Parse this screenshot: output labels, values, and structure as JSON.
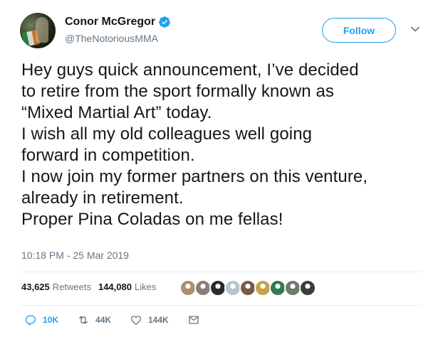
{
  "user": {
    "name": "Conor McGregor",
    "handle": "@TheNotoriousMMA",
    "verified": true
  },
  "follow_button": {
    "label": "Follow"
  },
  "tweet": {
    "text": "Hey guys quick announcement, I’ve decided\nto retire from the sport formally known as\n“Mixed Martial Art” today.\nI wish all my old colleagues well going\nforward in competition.\nI now join my former partners on this venture,\nalready in retirement.\nProper Pina Coladas on me fellas!",
    "timestamp": "10:18 PM - 25 Mar 2019"
  },
  "stats": {
    "retweets_count": "43,625",
    "retweets_label": "Retweets",
    "likes_count": "144,080",
    "likes_label": "Likes"
  },
  "liker_avatars": [
    {
      "name": "liker-avatar-1",
      "color": "#b08c6a"
    },
    {
      "name": "liker-avatar-2",
      "color": "#8a7f78"
    },
    {
      "name": "liker-avatar-3",
      "color": "#2b2b2b"
    },
    {
      "name": "liker-avatar-4",
      "color": "#b8c4cc"
    },
    {
      "name": "liker-avatar-5",
      "color": "#7a5a48"
    },
    {
      "name": "liker-avatar-6",
      "color": "#c8a24a"
    },
    {
      "name": "liker-avatar-7",
      "color": "#2f7d4c"
    },
    {
      "name": "liker-avatar-8",
      "color": "#6e7a6a"
    },
    {
      "name": "liker-avatar-9",
      "color": "#3a3a40"
    }
  ],
  "actions": {
    "replies": "10K",
    "retweets": "44K",
    "likes": "144K"
  },
  "colors": {
    "accent": "#1da1f2",
    "muted": "#657786",
    "text": "#14171a",
    "divider": "#e6ecf0"
  },
  "icons": {
    "verified": "verified-badge-icon",
    "caret": "chevron-down-icon",
    "reply": "reply-icon",
    "retweet": "retweet-icon",
    "like": "heart-icon",
    "message": "envelope-icon"
  }
}
